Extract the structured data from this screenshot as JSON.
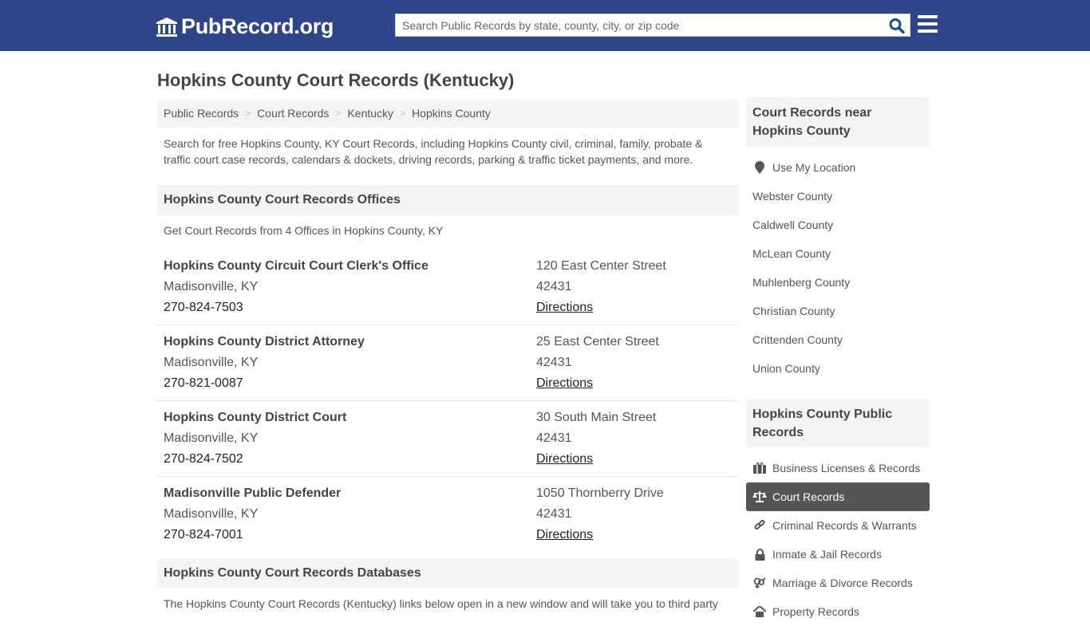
{
  "header": {
    "logo_text": "PubRecord.org",
    "search_placeholder": "Search Public Records by state, county, city, or zip code",
    "colors": {
      "brand": "#2e4589"
    }
  },
  "page_title": "Hopkins County Court Records (Kentucky)",
  "breadcrumb": [
    "Public Records",
    "Court Records",
    "Kentucky",
    "Hopkins County"
  ],
  "intro": "Search for free Hopkins County, KY Court Records, including Hopkins County civil, criminal, family, probate & traffic court case records, calendars & dockets, driving records, parking & traffic ticket payments, and more.",
  "offices_section": {
    "title": "Hopkins County Court Records Offices",
    "subtitle": "Get Court Records from 4 Offices in Hopkins County, KY",
    "offices": [
      {
        "name": "Hopkins County Circuit Court Clerk's Office",
        "city": "Madisonville, KY",
        "phone": "270-824-7503",
        "address": "120 East Center Street",
        "zip": "42431",
        "directions": "Directions"
      },
      {
        "name": "Hopkins County District Attorney",
        "city": "Madisonville, KY",
        "phone": "270-821-0087",
        "address": "25 East Center Street",
        "zip": "42431",
        "directions": "Directions"
      },
      {
        "name": "Hopkins County District Court",
        "city": "Madisonville, KY",
        "phone": "270-824-7502",
        "address": "30 South Main Street",
        "zip": "42431",
        "directions": "Directions"
      },
      {
        "name": "Madisonville Public Defender",
        "city": "Madisonville, KY",
        "phone": "270-824-7001",
        "address": "1050 Thornberry Drive",
        "zip": "42431",
        "directions": "Directions"
      }
    ]
  },
  "databases_section": {
    "title": "Hopkins County Court Records Databases",
    "text": "The Hopkins County Court Records (Kentucky) links below open in a new window and will take you to third party"
  },
  "sidebar": {
    "nearby": {
      "title": "Court Records near Hopkins County",
      "use_location": "Use My Location",
      "counties": [
        "Webster County",
        "Caldwell County",
        "McLean County",
        "Muhlenberg County",
        "Christian County",
        "Crittenden County",
        "Union County"
      ]
    },
    "public_records": {
      "title": "Hopkins County Public Records",
      "items": [
        {
          "label": "Business Licenses & Records",
          "icon": "briefcase-icon",
          "active": false
        },
        {
          "label": "Court Records",
          "icon": "scales-icon",
          "active": true
        },
        {
          "label": "Criminal Records & Warrants",
          "icon": "link-icon",
          "active": false
        },
        {
          "label": "Inmate & Jail Records",
          "icon": "lock-icon",
          "active": false
        },
        {
          "label": "Marriage & Divorce Records",
          "icon": "gender-icon",
          "active": false
        },
        {
          "label": "Property Records",
          "icon": "home-icon",
          "active": false
        }
      ]
    }
  }
}
